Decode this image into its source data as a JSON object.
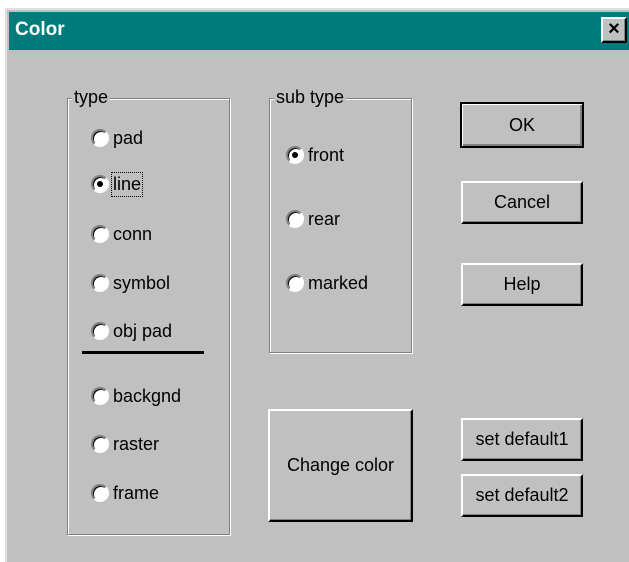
{
  "window": {
    "title": "Color",
    "close_label": "×"
  },
  "type_group": {
    "label": "type",
    "options": [
      {
        "label": "pad",
        "checked": false
      },
      {
        "label": "line",
        "checked": true
      },
      {
        "label": "conn",
        "checked": false
      },
      {
        "label": "symbol",
        "checked": false
      },
      {
        "label": "obj pad",
        "checked": false
      },
      {
        "label": "backgnd",
        "checked": false
      },
      {
        "label": "raster",
        "checked": false
      },
      {
        "label": "frame",
        "checked": false
      }
    ]
  },
  "subtype_group": {
    "label": "sub type",
    "options": [
      {
        "label": "front",
        "checked": true
      },
      {
        "label": "rear",
        "checked": false
      },
      {
        "label": "marked",
        "checked": false
      }
    ]
  },
  "buttons": {
    "ok": "OK",
    "cancel": "Cancel",
    "help": "Help",
    "change_color": "Change color",
    "set_default1": "set default1",
    "set_default2": "set default2"
  }
}
